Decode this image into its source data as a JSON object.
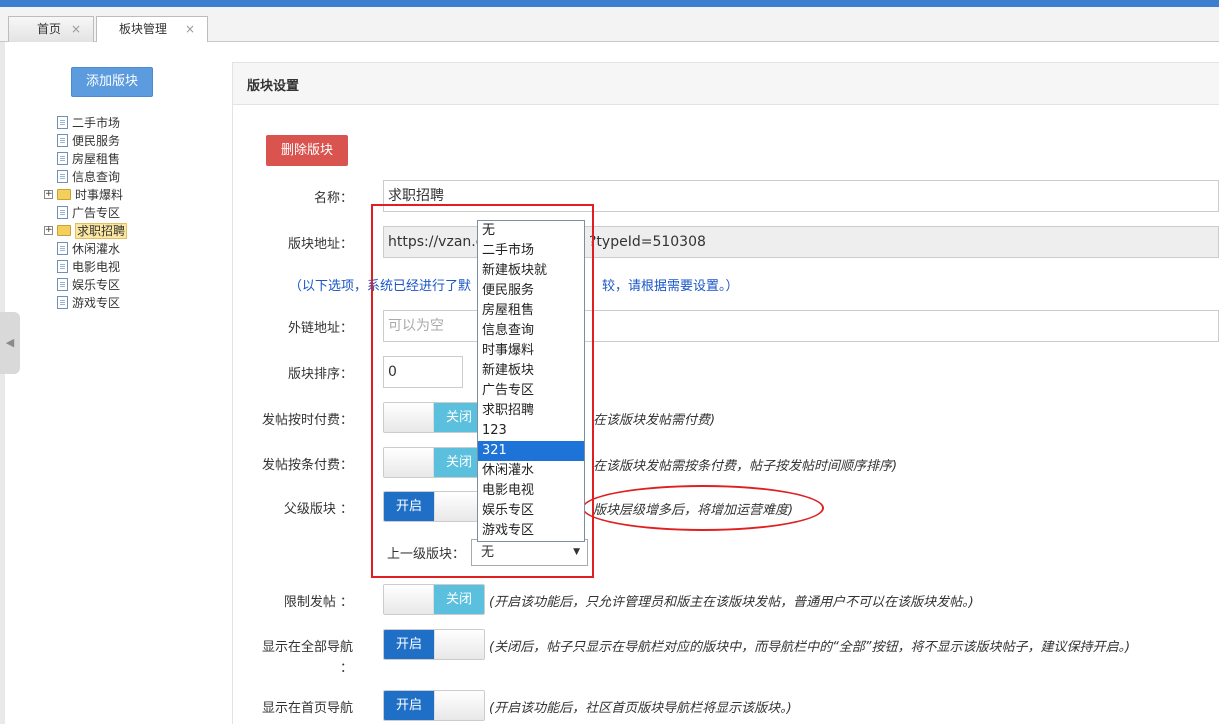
{
  "tabs": [
    {
      "label": "首页",
      "close": "×"
    },
    {
      "label": "板块管理",
      "close": "×"
    }
  ],
  "sidebar": {
    "add_button": "添加版块",
    "tree": [
      {
        "label": "二手市场",
        "type": "doc"
      },
      {
        "label": "便民服务",
        "type": "doc"
      },
      {
        "label": "房屋租售",
        "type": "doc"
      },
      {
        "label": "信息查询",
        "type": "doc"
      },
      {
        "label": "时事爆料",
        "type": "folder",
        "expander": "+"
      },
      {
        "label": "广告专区",
        "type": "doc"
      },
      {
        "label": "求职招聘",
        "type": "folder",
        "expander": "+",
        "selected": true
      },
      {
        "label": "休闲灌水",
        "type": "doc"
      },
      {
        "label": "电影电视",
        "type": "doc"
      },
      {
        "label": "娱乐专区",
        "type": "doc"
      },
      {
        "label": "游戏专区",
        "type": "doc"
      }
    ]
  },
  "panel": {
    "title": "版块设置",
    "delete_button": "删除版块",
    "name_label": "名称：",
    "name_value": "求职招聘",
    "url_label": "版块地址：",
    "url_value_left": "https://vzan.c",
    "url_value_right": "?typeId=510308",
    "notice_left": "（以下选项，系统已经进行了默",
    "notice_right": "较，请根据需要设置。）",
    "ext_link_label": "外链地址：",
    "ext_link_placeholder": "可以为空",
    "sort_label": "版块排序：",
    "sort_value": "0",
    "time_pay_label": "发帖按时付费：",
    "time_pay_toggle": "关闭",
    "time_pay_hint": "在该版块发帖需付费)",
    "count_pay_label": "发帖按条付费：",
    "count_pay_toggle": "关闭",
    "count_pay_hint": "在该版块发帖需按条付费，帖子按发帖时间顺序排序)",
    "parent_label": "父级版块 ：",
    "parent_toggle": "开启",
    "parent_hint": "版块层级增多后，将增加运营难度)",
    "parent_select_label": "上一级版块：",
    "parent_select_value": "无",
    "parent_select_arrow": "▼",
    "parent_options": [
      "无",
      "二手市场",
      "新建板块就",
      "便民服务",
      "房屋租售",
      "信息查询",
      "时事爆料",
      "新建板块",
      "广告专区",
      "求职招聘",
      "123",
      "321",
      "休闲灌水",
      "电影电视",
      "娱乐专区",
      "游戏专区"
    ],
    "parent_options_highlighted": "321",
    "restrict_label": "限制发帖 ：",
    "restrict_toggle": "关闭",
    "restrict_hint": "(开启该功能后，只允许管理员和版主在该版块发帖，普通用户不可以在该版块发帖。)",
    "show_all_label": "显示在全部导航",
    "show_all_label_colon": "：",
    "show_all_toggle": "开启",
    "show_all_hint": "(关闭后，帖子只显示在导航栏对应的版块中，而导航栏中的“全部”按钮，将不显示该版块帖子，建议保持开启。)",
    "show_home_label": "显示在首页导航",
    "show_home_toggle": "开启",
    "show_home_hint": "(开启该功能后，社区首页版块导航栏将显示该版块。)"
  },
  "colors": {
    "accent": "#3c7fd1",
    "danger": "#d9534f",
    "toggle_on": "#1f6fc7",
    "toggle_off": "#5bc0de",
    "annotation": "#e02020"
  },
  "icons": {
    "collapse": "chevron-left-icon",
    "select_arrow": "caret-down-icon",
    "tree_doc": "document-icon",
    "tree_folder": "folder-icon"
  }
}
